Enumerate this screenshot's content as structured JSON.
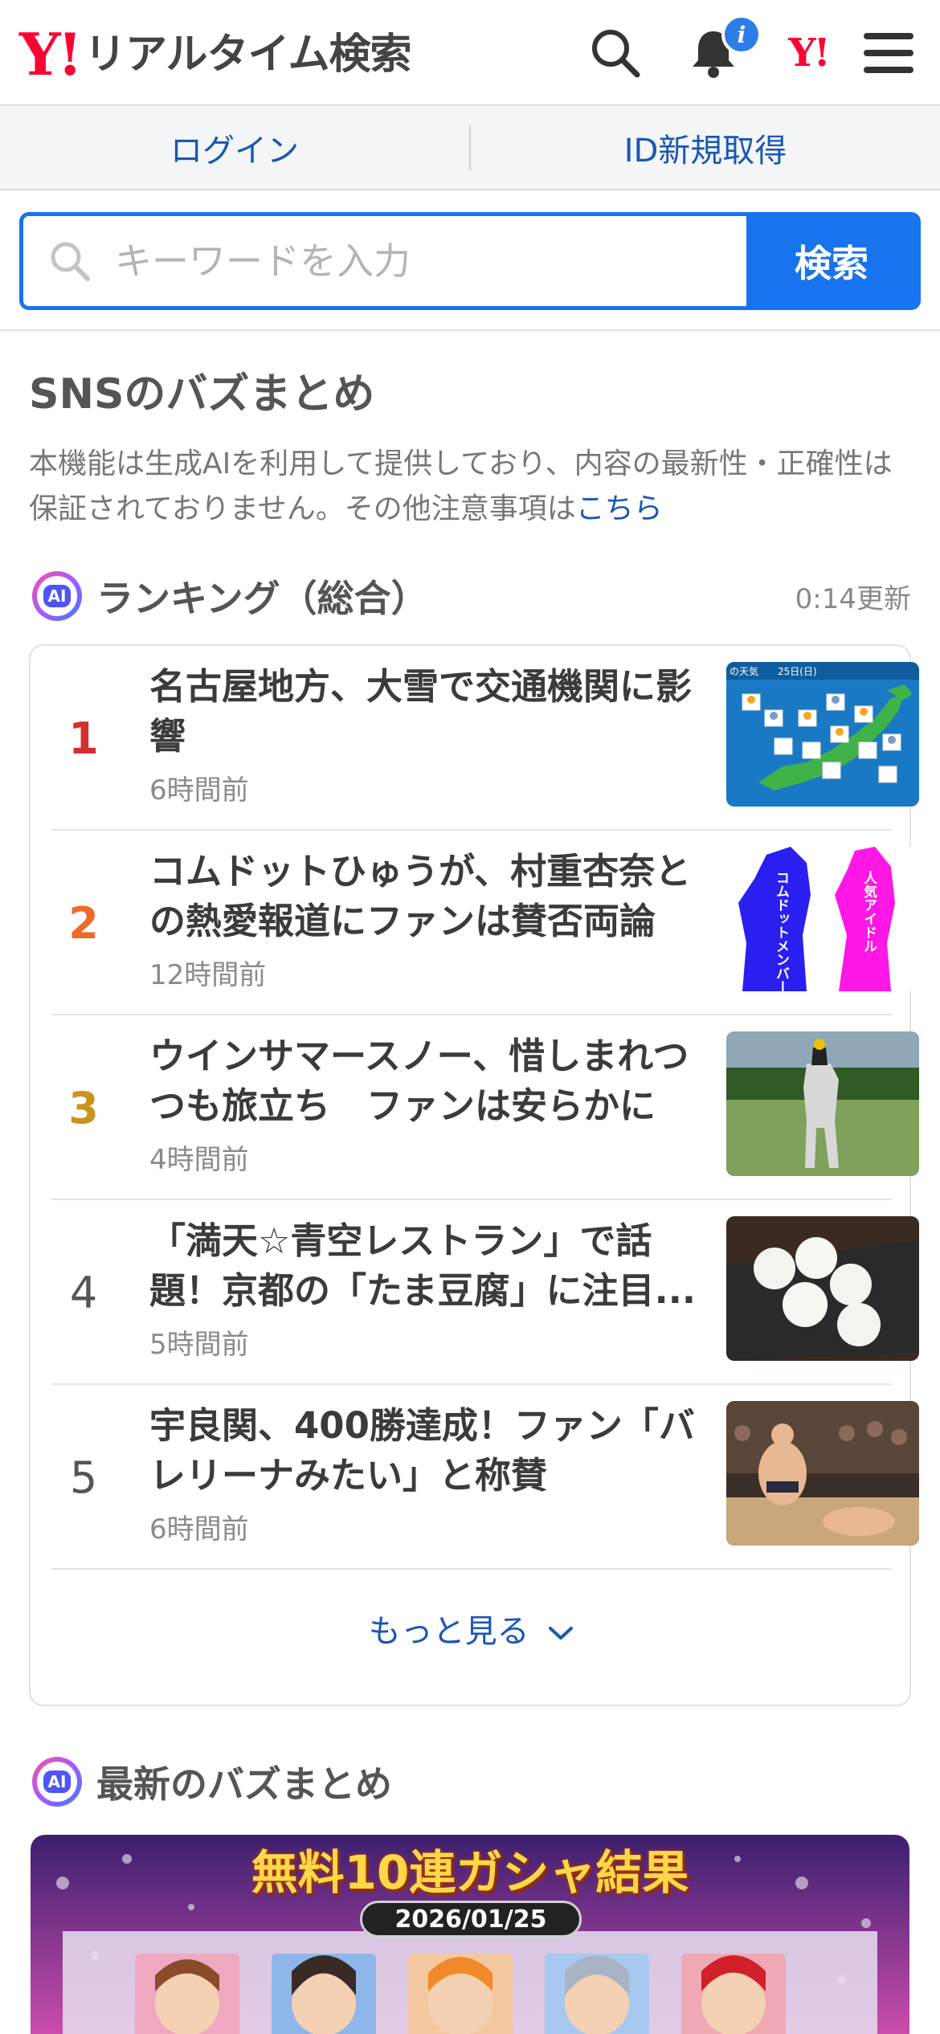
{
  "header": {
    "logo_mark": "Y!",
    "logo_text": "リアルタイム検索",
    "notification_badge": "i",
    "yj_mark": "Y!"
  },
  "login_bar": {
    "login": "ログイン",
    "register": "ID新規取得"
  },
  "search": {
    "placeholder": "キーワードを入力",
    "button": "検索"
  },
  "sns": {
    "title": "SNSのバズまとめ",
    "disclaimer": "本機能は生成AIを利用して提供しており、内容の最新性・正確性は保証されておりません。その他注意事項は",
    "disclaimer_link": "こちら"
  },
  "ranking": {
    "badge": "AI",
    "title": "ランキング（総合）",
    "updated": "0:14更新",
    "items": [
      {
        "rank": "1",
        "title": "名古屋地方、大雪で交通機関に影響",
        "time": "6時間前",
        "color": "#d03030"
      },
      {
        "rank": "2",
        "title": "コムドットひゅうが、村重杏奈との熱愛報道にファンは賛否両論",
        "time": "12時間前",
        "color": "#ee6a2a"
      },
      {
        "rank": "3",
        "title": "ウインサマースノー、惜しまれつつも旅立ち　ファンは安らかに",
        "time": "4時間前",
        "color": "#c99418"
      },
      {
        "rank": "4",
        "title": "「満天☆青空レストラン」で話題！京都の「たま豆腐」に注目...",
        "time": "5時間前",
        "color": "#555555"
      },
      {
        "rank": "5",
        "title": "宇良関、400勝達成！ファン「バレリーナみたい」と称賛",
        "time": "6時間前",
        "color": "#555555"
      }
    ],
    "more": "もっと見る"
  },
  "thumb_texts": {
    "weather_caption": "の天気　　25日(日)",
    "left_label": "コムドットメンバー",
    "right_label": "人気アイドル"
  },
  "latest": {
    "badge": "AI",
    "title": "最新のバズまとめ",
    "banner_title": "無料10連ガシャ結果",
    "banner_date": "2026/01/25"
  },
  "colors": {
    "accent_blue": "#1873ee",
    "link_blue": "#1a57b4",
    "yahoo_red": "#ff0033"
  }
}
